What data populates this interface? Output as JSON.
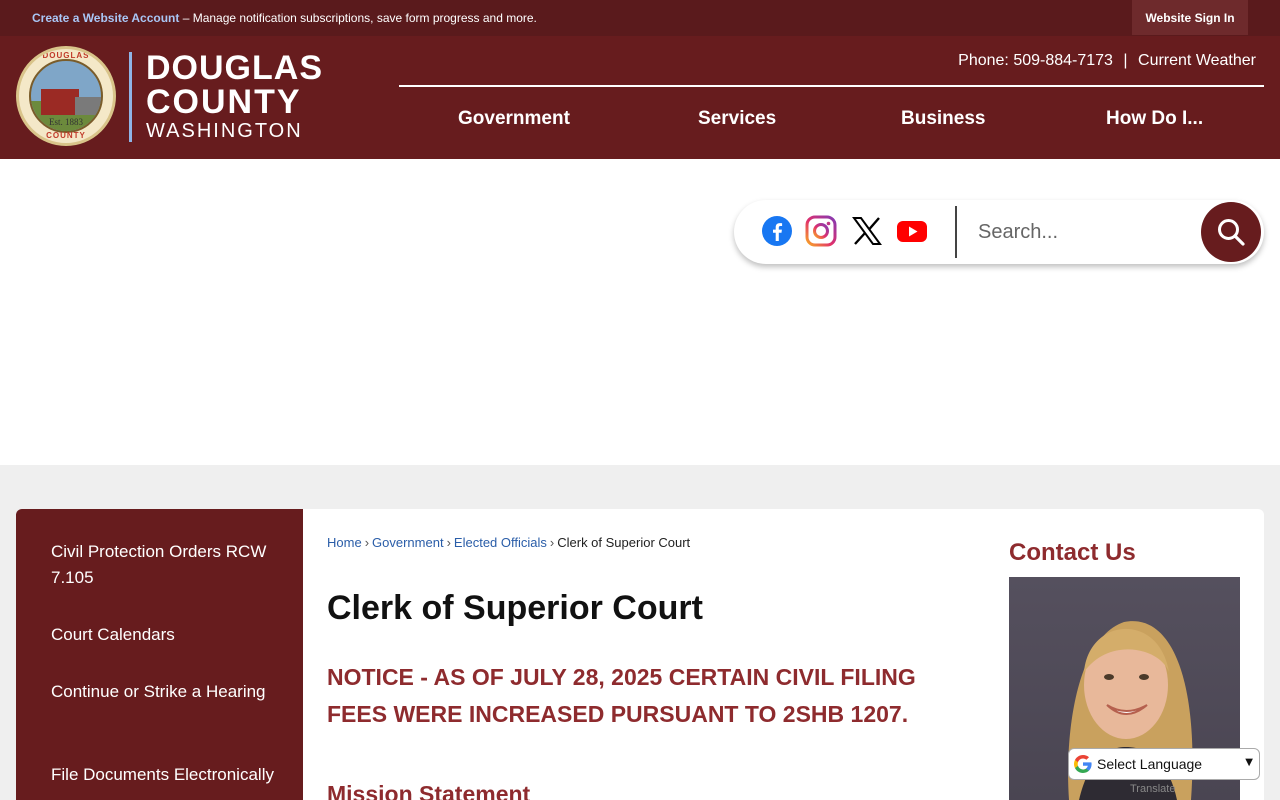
{
  "topbar": {
    "create_account_link": "Create a Website Account",
    "create_account_desc": " – Manage notification subscriptions, save form progress and more.",
    "sign_in": "Website Sign In"
  },
  "header": {
    "logo": {
      "line1": "DOUGLAS",
      "line2": "COUNTY",
      "line3": "WASHINGTON",
      "seal_top": "DOUGLAS",
      "seal_est": "Est. 1883",
      "seal_bottom": "COUNTY"
    },
    "phone": "Phone: 509-884-7173",
    "separator": "|",
    "weather": "Current Weather",
    "nav": [
      "Government",
      "Services",
      "Business",
      "How Do I..."
    ]
  },
  "social": {
    "icons": [
      "facebook-icon",
      "instagram-icon",
      "x-twitter-icon",
      "youtube-icon"
    ],
    "search_placeholder": "Search..."
  },
  "sidebar": {
    "items": [
      "Civil Protection Orders RCW 7.105",
      "Court Calendars",
      "Continue or Strike a Hearing",
      "File Documents Electronically"
    ]
  },
  "main": {
    "breadcrumb": [
      "Home",
      "Government",
      "Elected Officials",
      "Clerk of Superior Court"
    ],
    "breadcrumb_sep": "›",
    "title": "Clerk of Superior Court",
    "notice": "NOTICE - AS OF JULY 28, 2025 CERTAIN CIVIL FILING FEES WERE INCREASED PURSUANT TO 2SHB 1207.",
    "mission_heading": "Mission Statement",
    "contact_title": "Contact Us"
  },
  "translate": {
    "label": "Select Language",
    "powered": "Translate"
  },
  "colors": {
    "brand_dark": "#671c1e",
    "topbar": "#5a1a1c",
    "accent_red": "#8e2b2e",
    "link_blue": "#2a5da8"
  }
}
